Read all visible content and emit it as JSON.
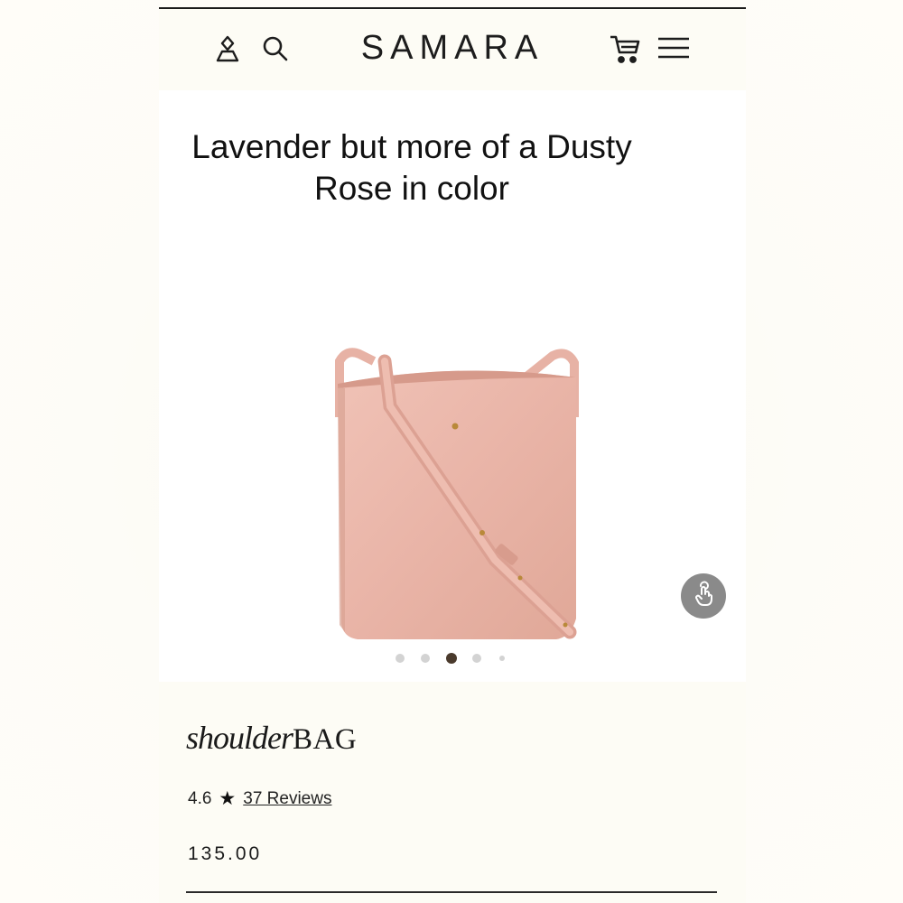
{
  "header": {
    "brand": "SAMARA",
    "icons": [
      "account-icon",
      "search-icon",
      "cart-icon",
      "menu-icon"
    ]
  },
  "product": {
    "caption": "Lavender but more of a Dusty Rose in color",
    "carousel": {
      "total": 5,
      "active": 3
    },
    "title_script": "shoulder",
    "title_caps": "BAG",
    "rating": "4.6",
    "reviews_label": "37 Reviews",
    "price": "135.00"
  },
  "colors": {
    "bag": "#e8b3a6",
    "dot_active": "#4a3a2c",
    "dot_inactive": "#d3d3d3",
    "touch_button": "#8a8a8a"
  }
}
